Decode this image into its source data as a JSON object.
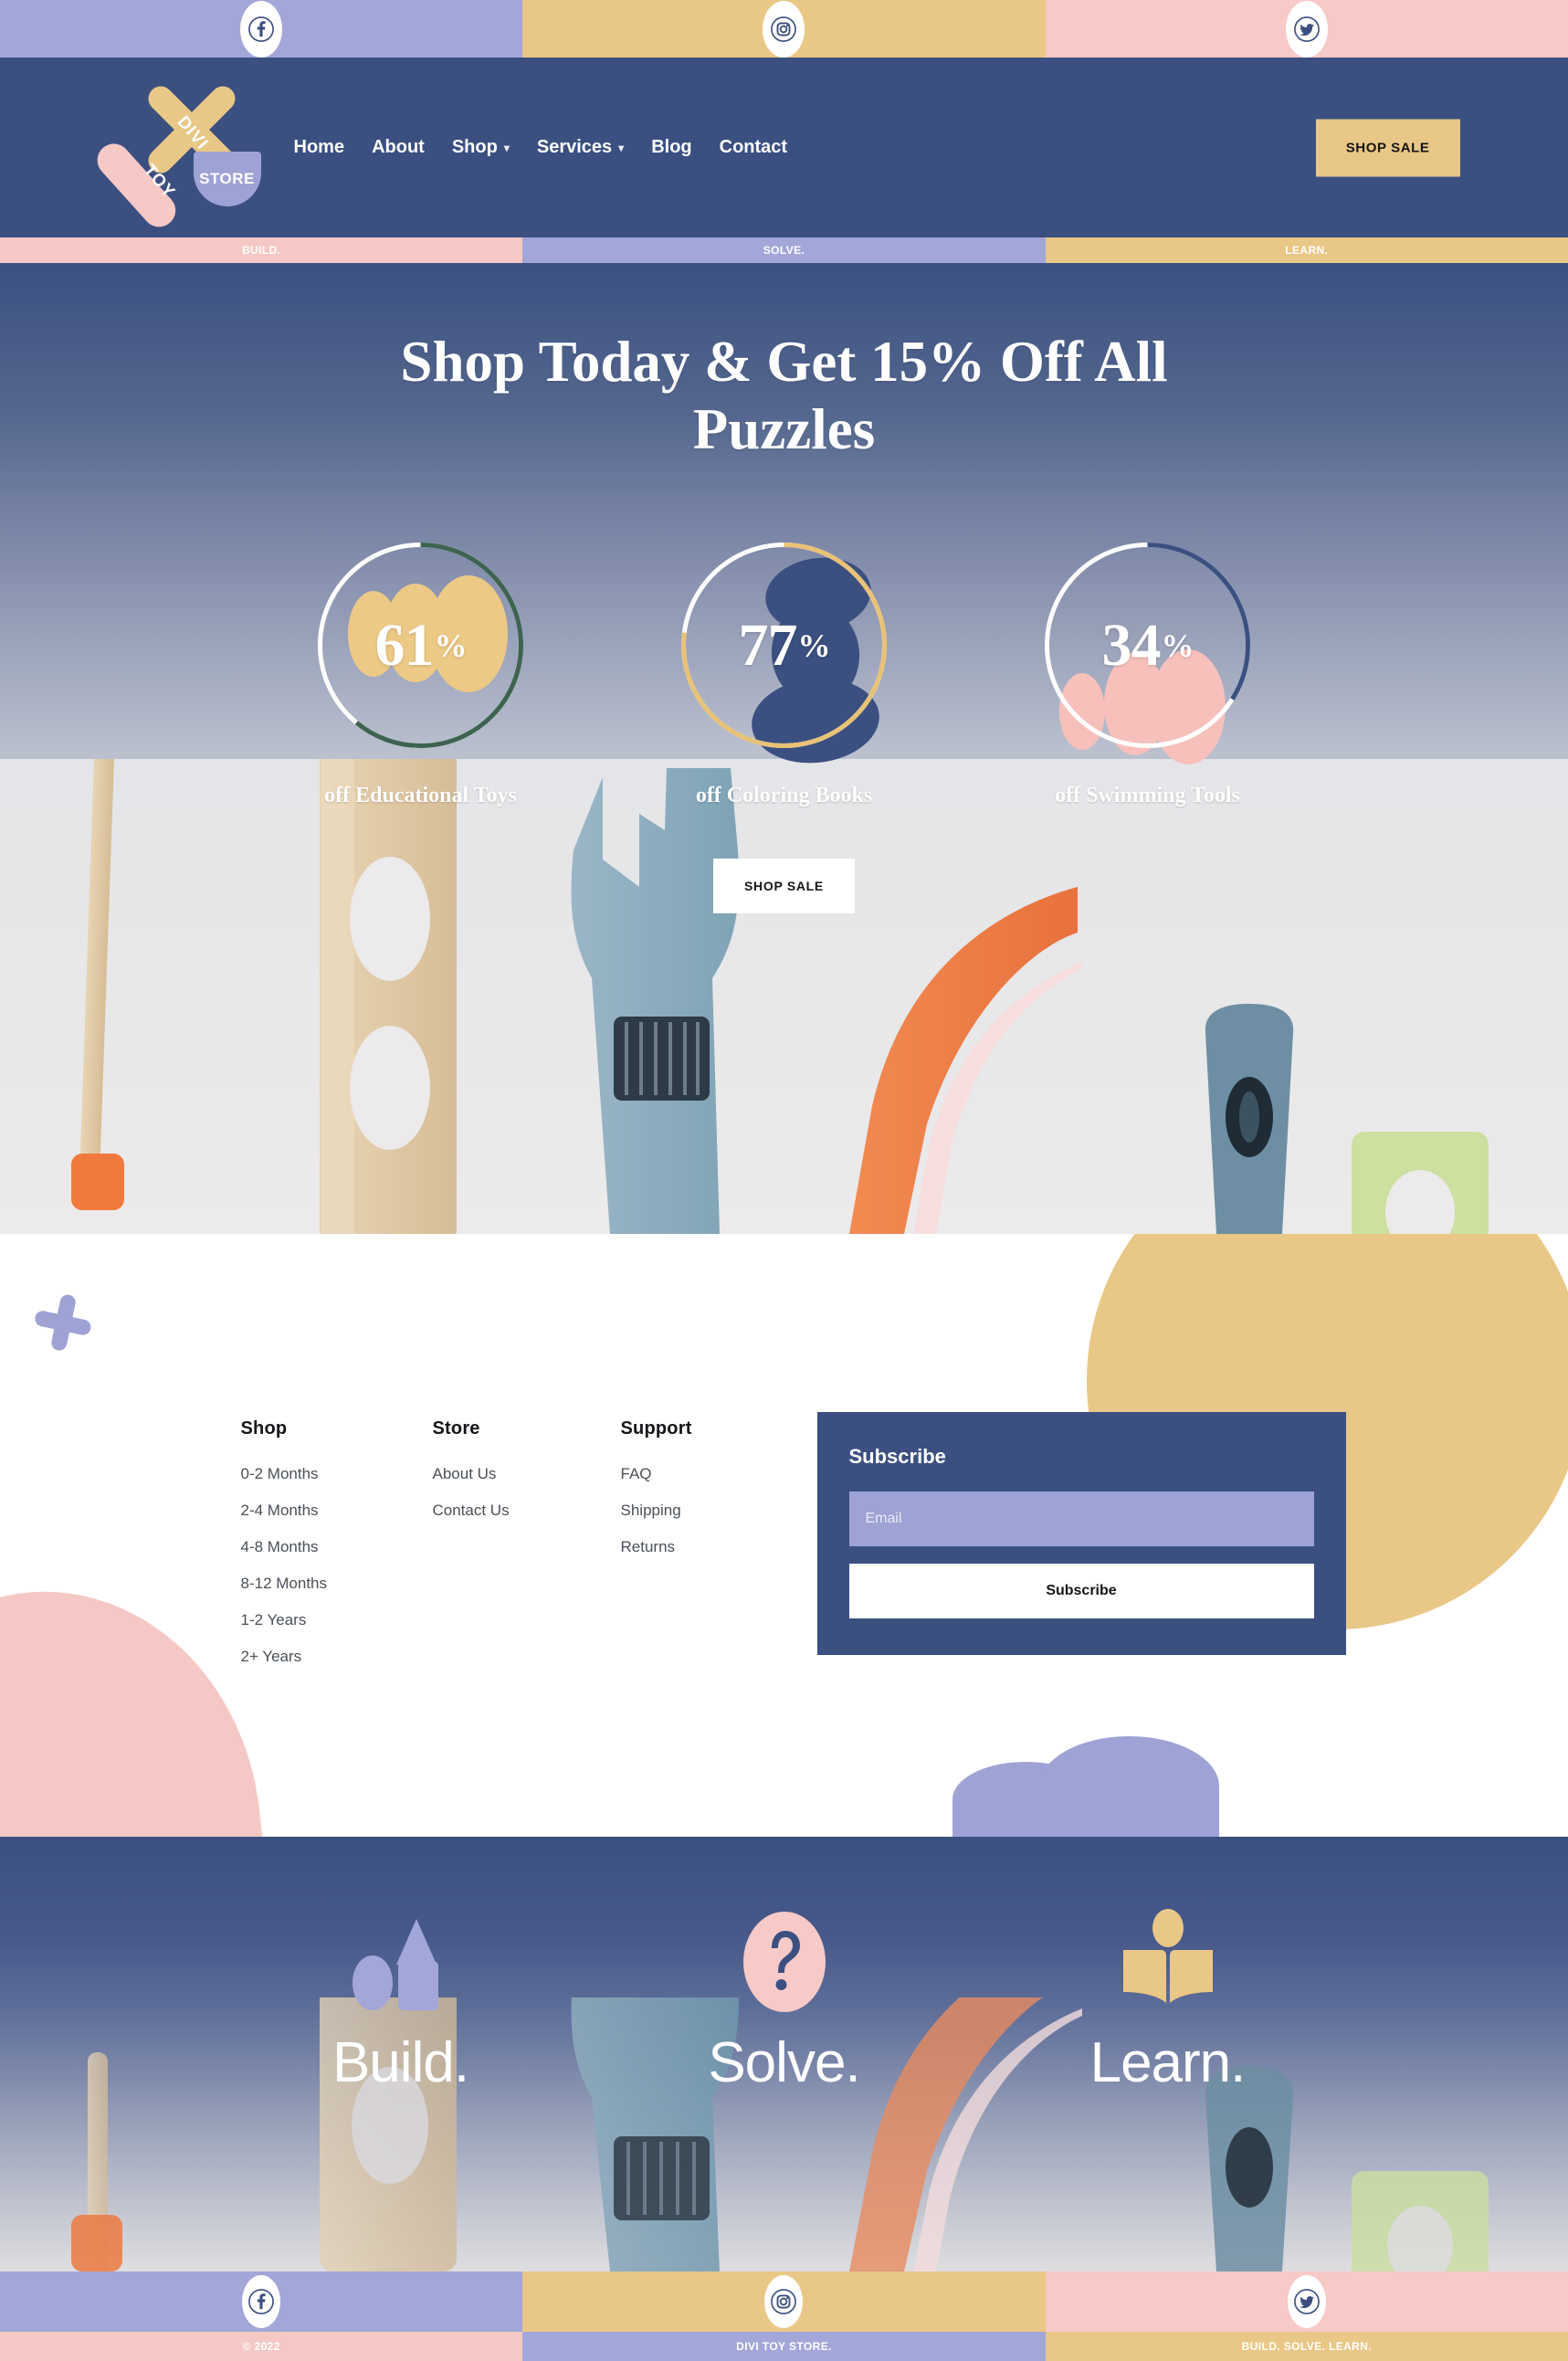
{
  "brand": {
    "logo_divi": "DIVI",
    "logo_toy": "TOY",
    "logo_store": "STORE"
  },
  "social_top": [
    {
      "name": "facebook",
      "icon": "facebook-icon",
      "bg": "#a3a6d8"
    },
    {
      "name": "instagram",
      "icon": "instagram-icon",
      "bg": "#e9c786"
    },
    {
      "name": "twitter",
      "icon": "twitter-icon",
      "bg": "#f7c9c7"
    }
  ],
  "nav": {
    "items": [
      {
        "label": "Home",
        "has_dropdown": false
      },
      {
        "label": "About",
        "has_dropdown": false
      },
      {
        "label": "Shop",
        "has_dropdown": true
      },
      {
        "label": "Services",
        "has_dropdown": true
      },
      {
        "label": "Blog",
        "has_dropdown": false
      },
      {
        "label": "Contact",
        "has_dropdown": false
      }
    ],
    "cta_label": "SHOP SALE"
  },
  "tagline_strip": [
    {
      "label": "BUILD.",
      "bg": "#f5c8c5"
    },
    {
      "label": "SOLVE.",
      "bg": "#a3a6d8"
    },
    {
      "label": "LEARN.",
      "bg": "#e9c786"
    }
  ],
  "hero": {
    "title": "Shop Today & Get 15% Off All Puzzles",
    "cta_label": "SHOP SALE"
  },
  "chart_data": {
    "type": "pie",
    "title": "Discount circle counters",
    "legend_position": "below-each",
    "items": [
      {
        "value": 61,
        "display": "61",
        "suffix": "%",
        "label": "off Educational Toys",
        "ring_color": "#3e6350",
        "track_color": "#ffffff",
        "blob_color": "#edc986"
      },
      {
        "value": 77,
        "display": "77",
        "suffix": "%",
        "label": "off Coloring Books",
        "ring_color": "#e9c276",
        "track_color": "#ffffff",
        "blob_color": "#3b5081"
      },
      {
        "value": 34,
        "display": "34",
        "suffix": "%",
        "label": "off Swimming Tools",
        "ring_color": "#3b5081",
        "track_color": "#ffffff",
        "blob_color": "#f7c0bb"
      }
    ]
  },
  "footer": {
    "columns": [
      {
        "heading": "Shop",
        "links": [
          "0-2 Months",
          "2-4 Months",
          "4-8 Months",
          "8-12 Months",
          "1-2 Years",
          "2+ Years"
        ]
      },
      {
        "heading": "Store",
        "links": [
          "About Us",
          "Contact Us"
        ]
      },
      {
        "heading": "Support",
        "links": [
          "FAQ",
          "Shipping",
          "Returns"
        ]
      }
    ],
    "subscribe": {
      "heading": "Subscribe",
      "email_placeholder": "Email",
      "email_value": "",
      "button_label": "Subscribe"
    }
  },
  "bsl_banner": [
    {
      "word": "Build.",
      "icon": "blocks-icon",
      "color": "#a3a6d8"
    },
    {
      "word": "Solve.",
      "icon": "question-mark-icon",
      "color": "#f7c9c7"
    },
    {
      "word": "Learn.",
      "icon": "open-book-icon",
      "color": "#e9c786"
    }
  ],
  "social_bottom": [
    {
      "name": "facebook",
      "icon": "facebook-icon",
      "bg": "#a3a6d8"
    },
    {
      "name": "instagram",
      "icon": "instagram-icon",
      "bg": "#e9c786"
    },
    {
      "name": "twitter",
      "icon": "twitter-icon",
      "bg": "#f7c9c7"
    }
  ],
  "copyright_strip": [
    {
      "label": "© 2022",
      "bg": "#f5c8c5"
    },
    {
      "label": "DIVI TOY STORE.",
      "bg": "#a3a6d8"
    },
    {
      "label": "BUILD. SOLVE. LEARN.",
      "bg": "#e9c786"
    }
  ],
  "colors": {
    "navy": "#3b5081",
    "purple": "#a3a6d8",
    "yellow": "#e9c786",
    "pink": "#f5c8c5",
    "white": "#ffffff"
  }
}
